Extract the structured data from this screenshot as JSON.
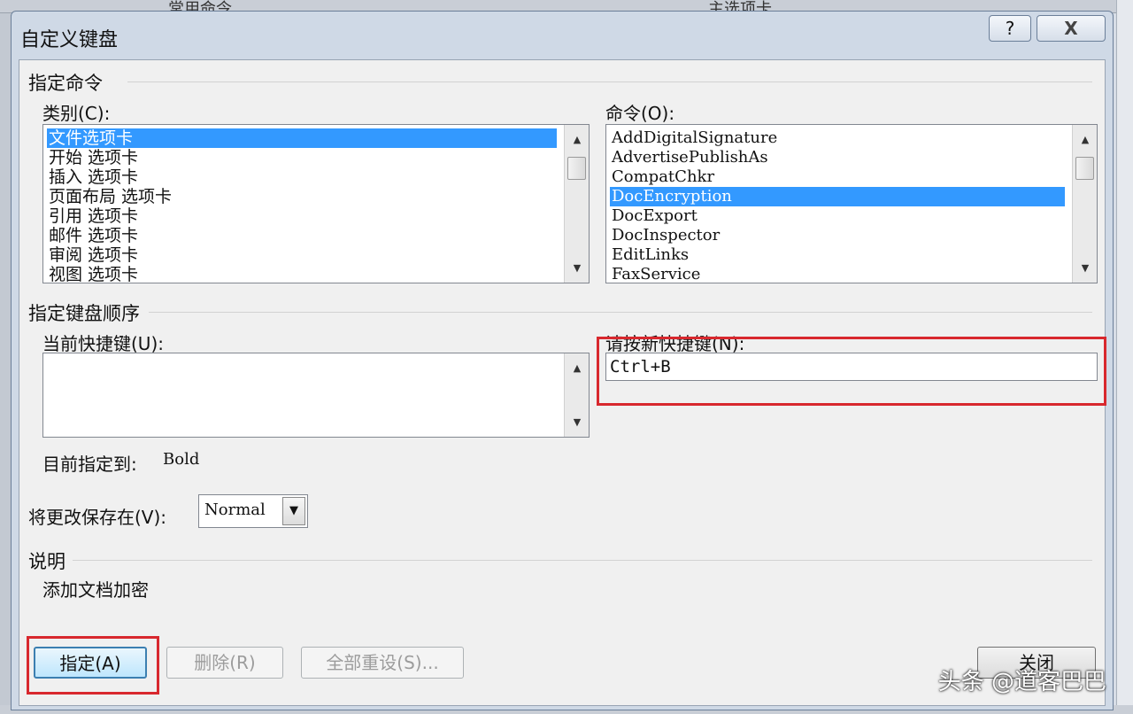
{
  "background": {
    "top_left_text": "常用命令",
    "top_right_text": "主选项卡"
  },
  "dialog": {
    "title": "自定义键盘",
    "help_label": "?",
    "close_label": "X"
  },
  "assign_command": {
    "group_label": "指定命令",
    "categories_label": "类别(C):",
    "categories": [
      "文件选项卡",
      "开始 选项卡",
      "插入 选项卡",
      "页面布局 选项卡",
      "引用 选项卡",
      "邮件 选项卡",
      "审阅 选项卡",
      "视图 选项卡"
    ],
    "selected_category": "文件选项卡",
    "commands_label": "命令(O):",
    "commands": [
      "AddDigitalSignature",
      "AdvertisePublishAs",
      "CompatChkr",
      "DocEncryption",
      "DocExport",
      "DocInspector",
      "EditLinks",
      "FaxService"
    ],
    "selected_command": "DocEncryption"
  },
  "keyboard_sequence": {
    "group_label": "指定键盘顺序",
    "current_keys_label": "当前快捷键(U):",
    "current_keys": [],
    "new_key_label": "请按新快捷键(N):",
    "new_key_value": "Ctrl+B",
    "assigned_to_label": "目前指定到:",
    "assigned_to_value": "Bold"
  },
  "save_in": {
    "label": "将更改保存在(V):",
    "value": "Normal"
  },
  "description": {
    "group_label": "说明",
    "text": "添加文档加密"
  },
  "buttons": {
    "assign": "指定(A)",
    "remove": "删除(R)",
    "reset_all": "全部重设(S)...",
    "close": "关闭"
  },
  "watermark": "头条 @道客巴巴",
  "colors": {
    "selection": "#3399ff",
    "highlight_box": "#d8282e"
  }
}
